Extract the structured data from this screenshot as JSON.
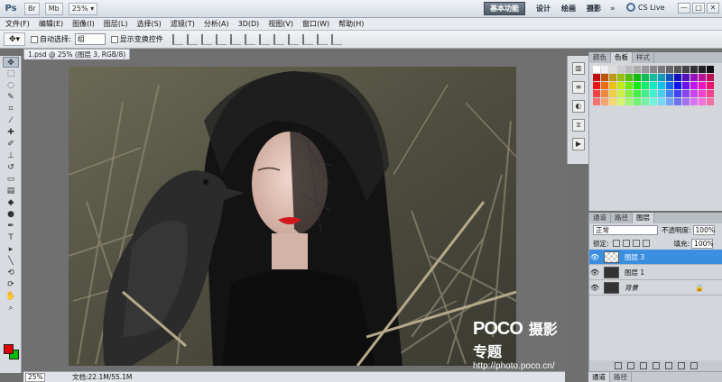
{
  "app": {
    "logo": "Ps",
    "app_buttons": [
      "Br",
      "Mb"
    ],
    "zoom": "25%",
    "workspaces": {
      "active": "基本功能",
      "items": [
        "设计",
        "绘画",
        "摄影"
      ],
      "more": "»"
    },
    "cs_live": "CS Live",
    "window_buttons": [
      "—",
      "□",
      "✕"
    ]
  },
  "menu": [
    "文件(F)",
    "编辑(E)",
    "图像(I)",
    "图层(L)",
    "选择(S)",
    "滤镜(T)",
    "分析(A)",
    "3D(D)",
    "视图(V)",
    "窗口(W)",
    "帮助(H)"
  ],
  "options": {
    "auto_select_label": "自动选择:",
    "auto_select_value": "组",
    "show_transform_label": "显示变换控件"
  },
  "document": {
    "tab_title": "1.psd @ 25% (图层 3, RGB/8) *",
    "tab_close": "×",
    "status_zoom": "25%",
    "status_info": "文档:22.1M/55.1M"
  },
  "watermark": {
    "logo": "POCO",
    "title": "摄影专题",
    "url": "http://photo.poco.cn/"
  },
  "swatch_panel": {
    "tabs": [
      "颜色",
      "色板",
      "样式"
    ],
    "active_tab": "色板"
  },
  "layers_panel": {
    "tabs": [
      "通道",
      "路径",
      "图层"
    ],
    "active_tab": "图层",
    "blend_mode": "正常",
    "opacity_label": "不透明度:",
    "opacity_value": "100%",
    "lock_label": "锁定:",
    "fill_label": "填充:",
    "fill_value": "100%",
    "layers": [
      {
        "name": "图层 3",
        "selected": true
      },
      {
        "name": "图层 1",
        "selected": false
      },
      {
        "name": "背景",
        "selected": false
      }
    ]
  },
  "bottom_tabs": [
    "通道",
    "路径"
  ],
  "colors": {
    "foreground": "#e00000",
    "background": "#00c000",
    "layer_selected": "#3b8fe0"
  }
}
